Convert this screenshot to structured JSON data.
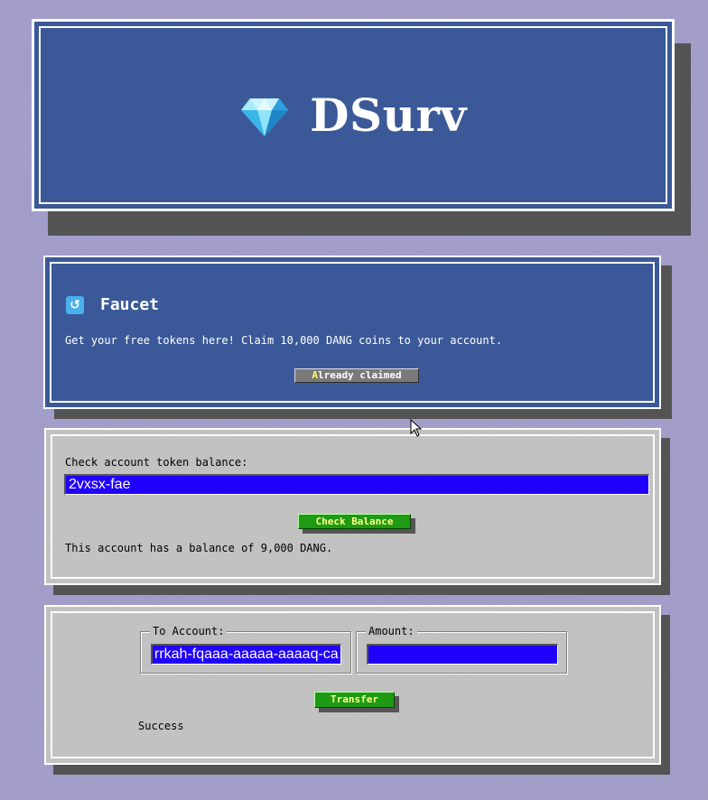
{
  "header": {
    "title": "DSurv",
    "logo_icon": "diamond-icon"
  },
  "faucet": {
    "icon": "faucet-icon",
    "icon_glyph": "↺",
    "title": "Faucet",
    "description": "Get your free tokens here! Claim 10,000 DANG coins to your account.",
    "button_first_letter": "A",
    "button_rest": "lready claimed"
  },
  "balance": {
    "label": "Check account token balance:",
    "account_value": "2vxsx-fae",
    "button_label": "Check Balance",
    "result": "This account has a balance of 9,000 DANG."
  },
  "transfer": {
    "to_label": "To Account:",
    "to_value": "rrkah-fqaaa-aaaaa-aaaaq-cai",
    "amount_label": "Amount:",
    "amount_value": "",
    "button_label": "Transfer",
    "status": "Success"
  },
  "colors": {
    "background": "#a09cc8",
    "header_blue": "#3b5998",
    "panel_gray": "#c0c0c0",
    "input_blue": "#2000ff",
    "button_green": "#1e9a14",
    "button_gray": "#7a7a7a",
    "shadow": "#545454"
  }
}
